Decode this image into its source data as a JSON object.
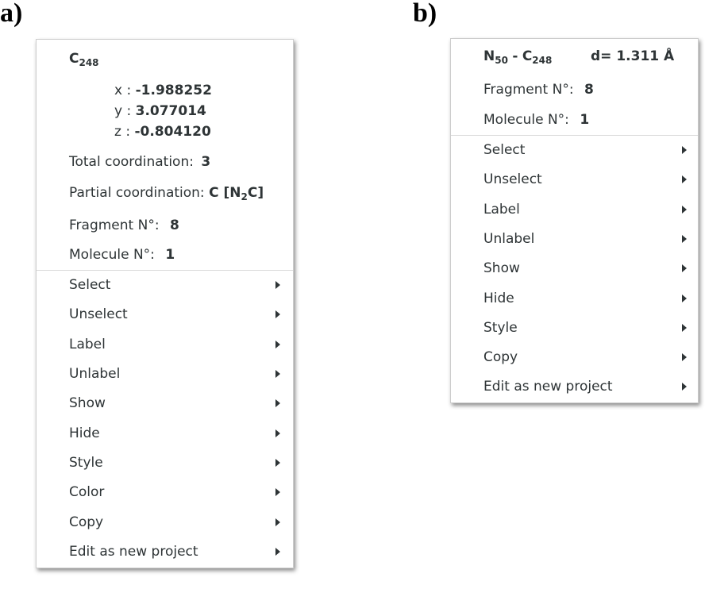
{
  "panels": {
    "a": {
      "letter": "a)",
      "atom": {
        "element": "C",
        "index": "248"
      },
      "coords": {
        "x_label": "x :",
        "x_value": "-1.988252",
        "y_label": "y :",
        "y_value": "3.077014",
        "z_label": "z :",
        "z_value": "-0.804120"
      },
      "total_coordination": {
        "label": "Total coordination:",
        "value": "3"
      },
      "partial_coordination": {
        "label": "Partial coordination:",
        "value_pre": "C [N",
        "value_sub": "2",
        "value_post": "C]"
      },
      "fragment": {
        "label": "Fragment N°:",
        "value": "8"
      },
      "molecule": {
        "label": "Molecule N°:",
        "value": "1"
      },
      "items": [
        {
          "label": "Select"
        },
        {
          "label": "Unselect"
        },
        {
          "label": "Label"
        },
        {
          "label": "Unlabel"
        },
        {
          "label": "Show"
        },
        {
          "label": "Hide"
        },
        {
          "label": "Style"
        },
        {
          "label": "Color"
        },
        {
          "label": "Copy"
        },
        {
          "label": "Edit as new project"
        }
      ]
    },
    "b": {
      "letter": "b)",
      "bond": {
        "atom1_element": "N",
        "atom1_index": "50",
        "separator": "-",
        "atom2_element": "C",
        "atom2_index": "248",
        "distance": "d= 1.311 Å"
      },
      "fragment": {
        "label": "Fragment N°:",
        "value": "8"
      },
      "molecule": {
        "label": "Molecule N°:",
        "value": "1"
      },
      "items": [
        {
          "label": "Select"
        },
        {
          "label": "Unselect"
        },
        {
          "label": "Label"
        },
        {
          "label": "Unlabel"
        },
        {
          "label": "Show"
        },
        {
          "label": "Hide"
        },
        {
          "label": "Style"
        },
        {
          "label": "Copy"
        },
        {
          "label": "Edit as new project"
        }
      ]
    }
  },
  "colors": {
    "text": "#2e3436",
    "border": "#cdcdcd",
    "separator": "#d9d9d9"
  },
  "icons": {
    "submenu": "triangle-right-icon"
  }
}
